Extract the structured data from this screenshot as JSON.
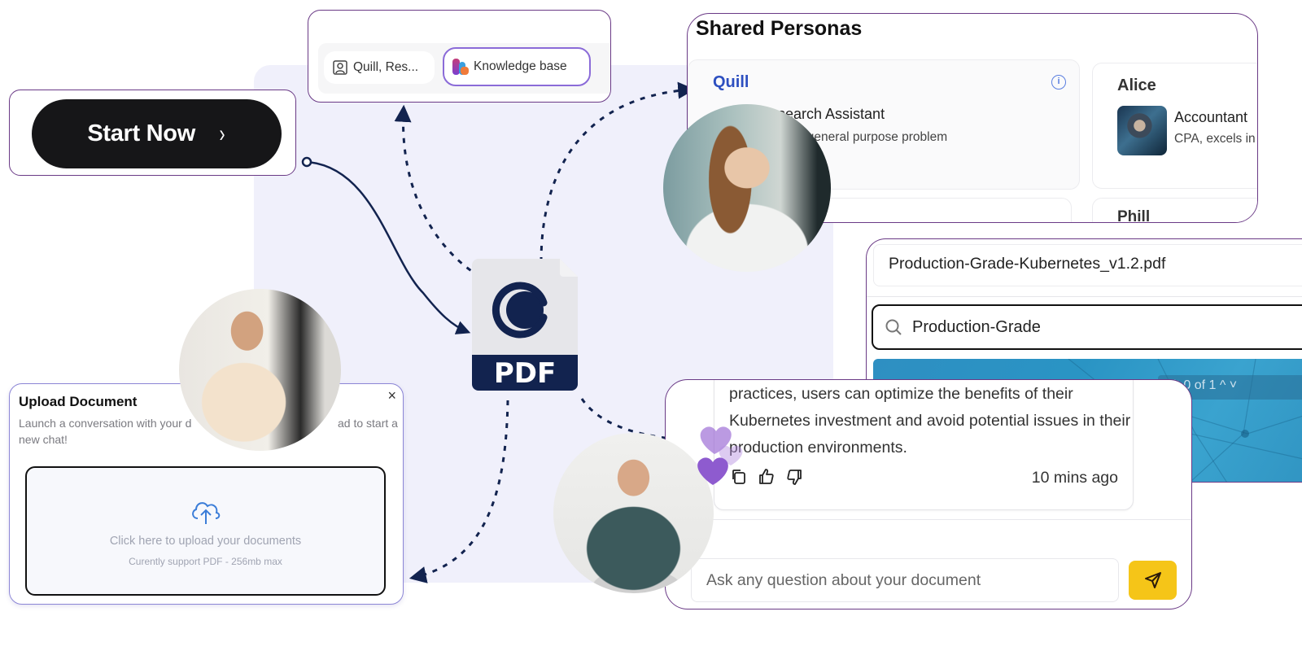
{
  "start": {
    "label": "Start Now",
    "chevron": "›"
  },
  "selector": {
    "persona_chip": "Quill, Res...",
    "kb_chip": "Knowledge base"
  },
  "personas": {
    "title": "Shared Personas",
    "cards": [
      {
        "name": "Quill",
        "role": "Research Assistant",
        "desc": "ss general purpose problem",
        "role_visible": "esearch Assistant"
      },
      {
        "name": "Alice",
        "role": "Accountant",
        "desc": "CPA, excels in"
      },
      {
        "name": "Phill"
      }
    ],
    "info_glyph": "i"
  },
  "pdf_icon": {
    "label": "PDF"
  },
  "viewer": {
    "file_name": "Production-Grade-Kubernetes_v1.2.pdf",
    "search_value": "Production-Grade",
    "search_result": "Search result 0 of 1",
    "search_result_visible": "ult 0 of 1  ^  ˅"
  },
  "chat": {
    "message": "practices, users can optimize the benefits of their Kubernetes investment and avoid potential issues in their production environments.",
    "timestamp": "10 mins ago",
    "input_placeholder": "Ask any question about your document",
    "accent": "#f5c518"
  },
  "upload": {
    "title": "Upload Document",
    "subtitle": "Launch a conversation with your document — upload to start a new chat!",
    "subtitle_visible_left": "Launch a conversation with your d",
    "subtitle_visible_right": "ad to start a",
    "subtitle_line2": "new chat!",
    "close": "×",
    "dropzone_main": "Click here to upload your documents",
    "dropzone_sub": "Curently support PDF - 256mb max"
  },
  "colors": {
    "frame": "#6a3a86",
    "navy": "#12234f",
    "quill_blue": "#2d4fc0",
    "kb_outline": "#8b6bd8",
    "backdrop": "#f0f0fb"
  }
}
